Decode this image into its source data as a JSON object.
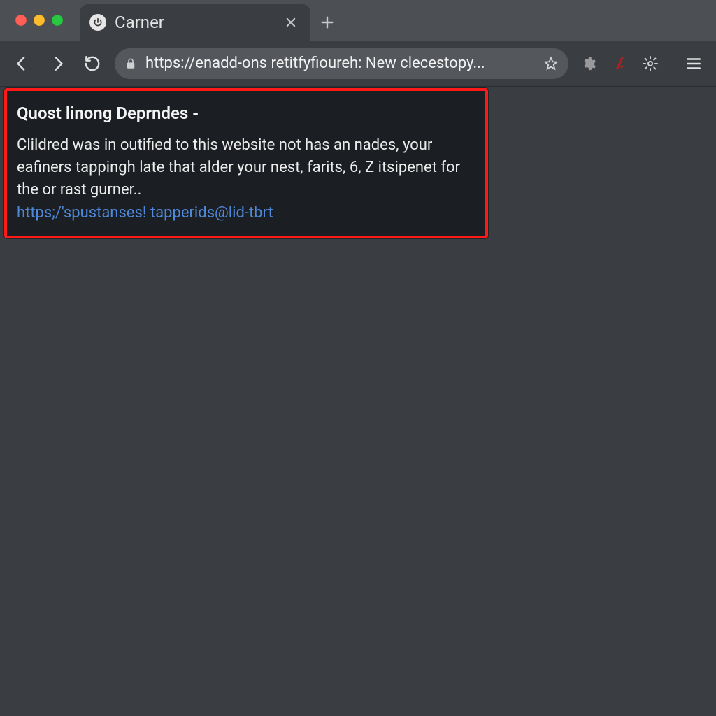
{
  "window": {
    "tab_title": "Carner"
  },
  "toolbar": {
    "url": "https://enadd-ons retitfyfioureh: New clecestopy..."
  },
  "notice": {
    "title": "Quost linong Deprndes -",
    "body": "Clildred was in outified to this website not has an nades, your eafiners tappingh late that alder your nest, farits, 6, Z itsipenet for the or rast gurner..",
    "link_text": "https;/'spustanses! tapperids@lid-tbrt"
  }
}
